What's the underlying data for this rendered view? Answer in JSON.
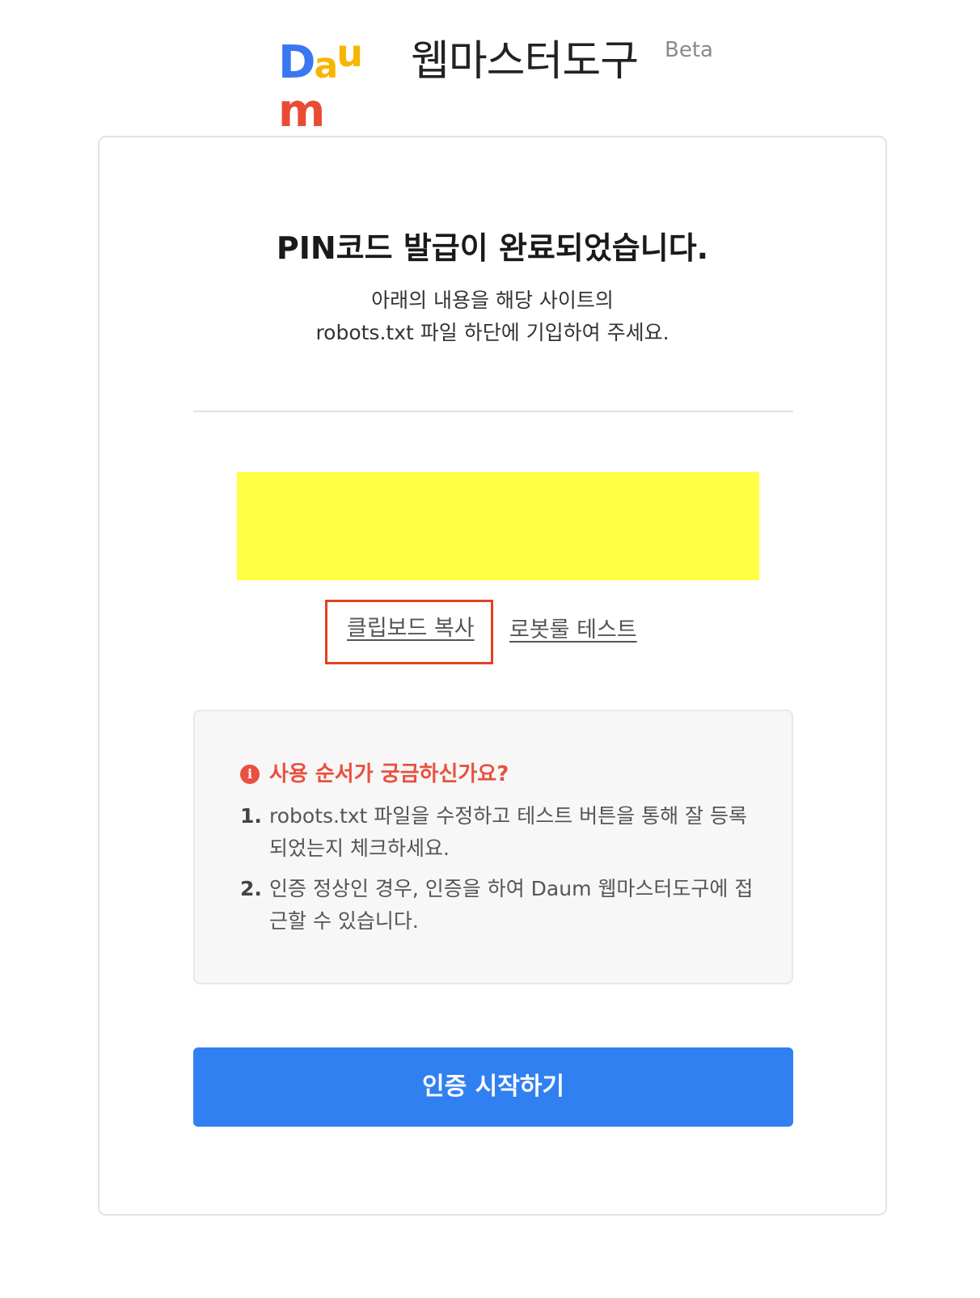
{
  "header": {
    "logo": {
      "d": "D",
      "a": "a",
      "u": "u",
      "m": "m",
      "alt": "Daum"
    },
    "title": "웹마스터도구",
    "badge": "Beta"
  },
  "card": {
    "title": "PIN코드 발급이 완료되었습니다.",
    "description_line1": "아래의 내용을 해당 사이트의",
    "description_line2": "robots.txt 파일 하단에 기입하여 주세요.",
    "pin_box_color": "#ffff44",
    "links": {
      "copy": "클립보드 복사",
      "test": "로봇룰 테스트"
    },
    "help": {
      "icon": "info-icon",
      "title": "사용 순서가 궁금하신가요?",
      "steps": [
        {
          "num": "1.",
          "text": "robots.txt 파일을 수정하고 테스트 버튼을 통해 잘 등록되었는지 체크하세요."
        },
        {
          "num": "2.",
          "text": "인증 정상인 경우, 인증을 하여 Daum 웹마스터도구에 접근할 수 있습니다."
        }
      ]
    },
    "primary_button": "인증 시작하기"
  },
  "colors": {
    "primary": "#3180f1",
    "alert": "#e9503f",
    "highlight_border": "#e5411f",
    "logo_blue": "#3a78f2",
    "logo_yellow": "#f7b500",
    "logo_red": "#e94b35"
  }
}
